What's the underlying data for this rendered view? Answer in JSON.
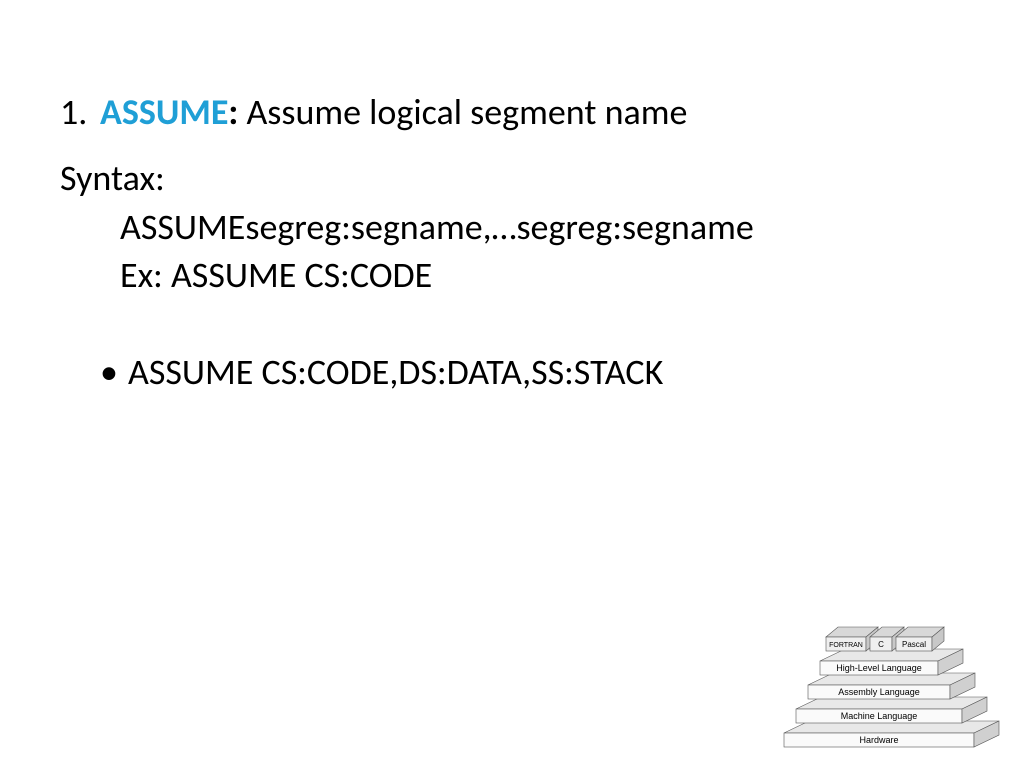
{
  "heading": {
    "number": "1.",
    "keyword": "ASSUME",
    "colon": ":",
    "description": " Assume logical segment name"
  },
  "syntax": {
    "label": "Syntax:",
    "line1": "ASSUMEsegreg:segname,…segreg:segname",
    "line2": "Ex: ASSUME CS:CODE"
  },
  "bullet": {
    "text": "ASSUME CS:CODE,DS:DATA,SS:STACK"
  },
  "pyramid": {
    "top": [
      "FORTRAN",
      "C",
      "Pascal"
    ],
    "levels": [
      "High-Level Language",
      "Assembly Language",
      "Machine Language",
      "Hardware"
    ]
  }
}
